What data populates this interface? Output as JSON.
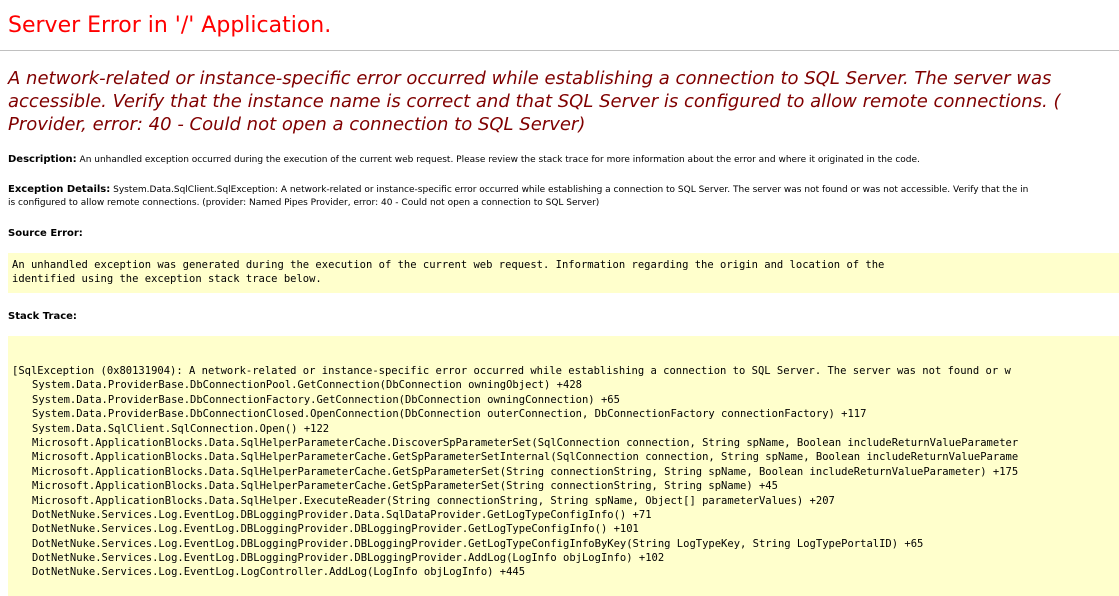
{
  "title": "Server Error in '/' Application.",
  "error_message": [
    "A network-related or instance-specific error occurred while establishing a connection to SQL Server. The server was",
    "accessible. Verify that the instance name is correct and that SQL Server is configured to allow remote connections. (",
    "Provider, error: 40 - Could not open a connection to SQL Server)"
  ],
  "description": {
    "label": "Description:",
    "text": " An unhandled exception occurred during the execution of the current web request. Please review the stack trace for more information about the error and where it originated in the code."
  },
  "exception_details": {
    "label": "Exception Details:",
    "line1": " System.Data.SqlClient.SqlException: A network-related or instance-specific error occurred while establishing a connection to SQL Server. The server was not found or was not accessible. Verify that the in",
    "line2": "is configured to allow remote connections. (provider: Named Pipes Provider, error: 40 - Could not open a connection to SQL Server)"
  },
  "source_error": {
    "label": "Source Error:",
    "lines": [
      "An unhandled exception was generated during the execution of the current web request. Information regarding the origin and location of the",
      "identified using the exception stack trace below."
    ]
  },
  "stack_trace": {
    "label": "Stack Trace:",
    "first_line": "[SqlException (0x80131904): A network-related or instance-specific error occurred while establishing a connection to SQL Server. The server was not found or w",
    "frames": [
      "System.Data.ProviderBase.DbConnectionPool.GetConnection(DbConnection owningObject) +428",
      "System.Data.ProviderBase.DbConnectionFactory.GetConnection(DbConnection owningConnection) +65",
      "System.Data.ProviderBase.DbConnectionClosed.OpenConnection(DbConnection outerConnection, DbConnectionFactory connectionFactory) +117",
      "System.Data.SqlClient.SqlConnection.Open() +122",
      "Microsoft.ApplicationBlocks.Data.SqlHelperParameterCache.DiscoverSpParameterSet(SqlConnection connection, String spName, Boolean includeReturnValueParameter",
      "Microsoft.ApplicationBlocks.Data.SqlHelperParameterCache.GetSpParameterSetInternal(SqlConnection connection, String spName, Boolean includeReturnValueParame",
      "Microsoft.ApplicationBlocks.Data.SqlHelperParameterCache.GetSpParameterSet(String connectionString, String spName, Boolean includeReturnValueParameter) +175",
      "Microsoft.ApplicationBlocks.Data.SqlHelperParameterCache.GetSpParameterSet(String connectionString, String spName) +45",
      "Microsoft.ApplicationBlocks.Data.SqlHelper.ExecuteReader(String connectionString, String spName, Object[] parameterValues) +207",
      "DotNetNuke.Services.Log.EventLog.DBLoggingProvider.Data.SqlDataProvider.GetLogTypeConfigInfo() +71",
      "DotNetNuke.Services.Log.EventLog.DBLoggingProvider.DBLoggingProvider.GetLogTypeConfigInfo() +101",
      "DotNetNuke.Services.Log.EventLog.DBLoggingProvider.DBLoggingProvider.GetLogTypeConfigInfoByKey(String LogTypeKey, String LogTypePortalID) +65",
      "DotNetNuke.Services.Log.EventLog.DBLoggingProvider.DBLoggingProvider.AddLog(LogInfo objLogInfo) +102",
      "DotNetNuke.Services.Log.EventLog.LogController.AddLog(LogInfo objLogInfo) +445"
    ]
  },
  "colors": {
    "title": "#ff0000",
    "message": "#800000",
    "code_background": "#ffffcc",
    "rule": "#c0c0c0"
  }
}
